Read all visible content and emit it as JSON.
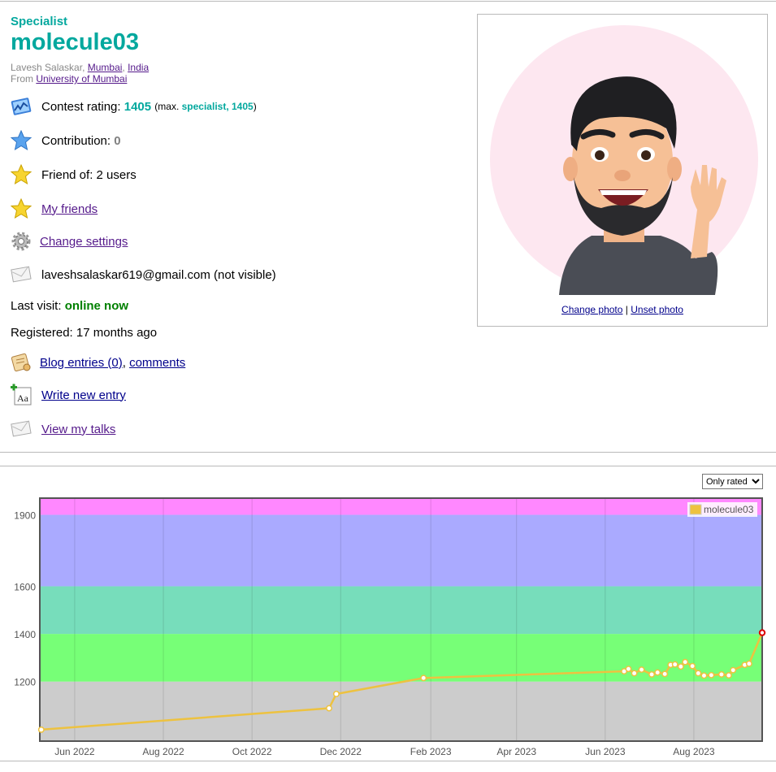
{
  "profile": {
    "rank": "Specialist",
    "handle": "molecule03",
    "name": "Lavesh Salaskar",
    "city": "Mumbai",
    "country": "India",
    "from_label": "From",
    "organization": "University of Mumbai",
    "accent_color": "#03a89e"
  },
  "info": {
    "rating_label": "Contest rating:",
    "rating_value": "1405",
    "max_open": "(max.",
    "max_rank": "specialist, 1405",
    "max_close": ")",
    "contribution_label": "Contribution:",
    "contribution_value": "0",
    "friend_of": "Friend of: 2 users",
    "my_friends": "My friends",
    "change_settings": "Change settings",
    "email": "laveshsalaskar619@gmail.com (not visible)",
    "last_visit_label": "Last visit:",
    "last_visit_value": "online now",
    "registered": "Registered: 17 months ago",
    "blog_entries": "Blog entries (0)",
    "comments": "comments",
    "write_entry": "Write new entry",
    "view_talks": "View my talks"
  },
  "photo": {
    "change_photo": "Change photo",
    "separator": "|",
    "unset_photo": "Unset photo"
  },
  "filter": {
    "selected": "Only rated"
  },
  "chart_data": {
    "type": "line",
    "legend": "molecule03",
    "ylim": [
      950,
      1970
    ],
    "y_ticks": [
      1200,
      1400,
      1600,
      1900
    ],
    "x_ticks": [
      "Jun 2022",
      "Aug 2022",
      "Oct 2022",
      "Dec 2022",
      "Feb 2023",
      "Apr 2023",
      "Jun 2023",
      "Aug 2023"
    ],
    "bands": [
      {
        "from": 950,
        "to": 1200,
        "color": "#cccccc"
      },
      {
        "from": 1200,
        "to": 1400,
        "color": "#77ff77"
      },
      {
        "from": 1400,
        "to": 1600,
        "color": "#77ddbb"
      },
      {
        "from": 1600,
        "to": 1900,
        "color": "#aaaaff"
      },
      {
        "from": 1900,
        "to": 1970,
        "color": "#ff88ff"
      }
    ],
    "series": [
      {
        "name": "molecule03",
        "color": "#edc240",
        "points": [
          [
            "2022-05-09",
            998
          ],
          [
            "2022-11-23",
            1088
          ],
          [
            "2022-11-28",
            1148
          ],
          [
            "2023-01-27",
            1215
          ],
          [
            "2023-06-14",
            1243
          ],
          [
            "2023-06-17",
            1253
          ],
          [
            "2023-06-21",
            1235
          ],
          [
            "2023-06-26",
            1250
          ],
          [
            "2023-07-03",
            1230
          ],
          [
            "2023-07-07",
            1238
          ],
          [
            "2023-07-12",
            1232
          ],
          [
            "2023-07-16",
            1270
          ],
          [
            "2023-07-19",
            1272
          ],
          [
            "2023-07-23",
            1263
          ],
          [
            "2023-07-26",
            1282
          ],
          [
            "2023-07-31",
            1265
          ],
          [
            "2023-08-04",
            1235
          ],
          [
            "2023-08-08",
            1225
          ],
          [
            "2023-08-13",
            1227
          ],
          [
            "2023-08-20",
            1230
          ],
          [
            "2023-08-25",
            1226
          ],
          [
            "2023-08-28",
            1248
          ],
          [
            "2023-09-05",
            1270
          ],
          [
            "2023-09-08",
            1275
          ],
          [
            "2023-09-17",
            1405
          ]
        ]
      }
    ]
  }
}
